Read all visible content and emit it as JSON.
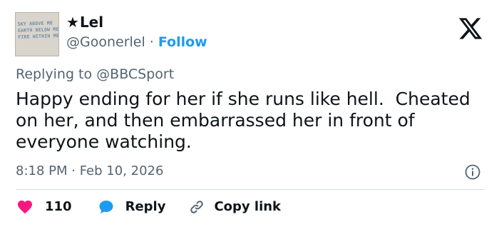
{
  "author": {
    "star": "★",
    "display_name": "Lel",
    "handle": "@Goonerlel",
    "separator": "·",
    "follow_label": "Follow",
    "avatar_text": "SKY ABOVE ME\nEARTH BELOW ME\nFIRE WITHIN ME"
  },
  "reply": {
    "prefix": "Replying to ",
    "mention": "@BBCSport"
  },
  "tweet": {
    "text": "Happy ending for her if she runs like hell.  Cheated on her, and then embarrassed her in front of everyone watching.",
    "timestamp": "8:18 PM · Feb 10, 2026"
  },
  "actions": {
    "like_count": "110",
    "reply_label": "Reply",
    "copy_link_label": "Copy link"
  },
  "icons": {
    "logo": "x-logo-icon",
    "like": "heart-icon",
    "reply": "speech-bubble-icon",
    "copy": "link-icon",
    "info": "info-icon"
  },
  "colors": {
    "accent": "#1d9bf0",
    "like": "#f91880",
    "text": "#0f1419",
    "secondary": "#536471",
    "divider": "#cfd9de"
  }
}
